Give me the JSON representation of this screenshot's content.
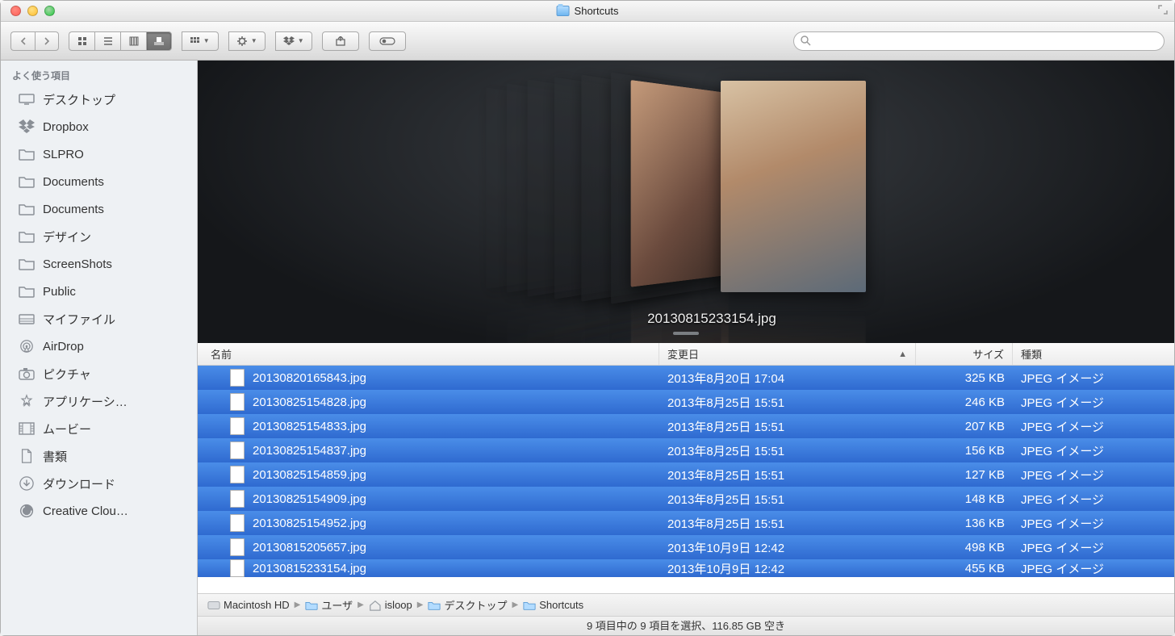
{
  "window": {
    "title": "Shortcuts"
  },
  "sidebar": {
    "section": "よく使う項目",
    "items": [
      {
        "icon": "desktop",
        "label": "デスクトップ"
      },
      {
        "icon": "dropbox",
        "label": "Dropbox"
      },
      {
        "icon": "folder",
        "label": "SLPRO"
      },
      {
        "icon": "folder",
        "label": "Documents"
      },
      {
        "icon": "folder",
        "label": "Documents"
      },
      {
        "icon": "folder",
        "label": "デザイン"
      },
      {
        "icon": "folder",
        "label": "ScreenShots"
      },
      {
        "icon": "folder",
        "label": "Public"
      },
      {
        "icon": "allmyfiles",
        "label": "マイファイル"
      },
      {
        "icon": "airdrop",
        "label": "AirDrop"
      },
      {
        "icon": "camera",
        "label": "ピクチャ"
      },
      {
        "icon": "apps",
        "label": "アプリケーシ…"
      },
      {
        "icon": "movies",
        "label": "ムービー"
      },
      {
        "icon": "document",
        "label": "書類"
      },
      {
        "icon": "downloads",
        "label": "ダウンロード"
      },
      {
        "icon": "cc",
        "label": "Creative Clou…"
      }
    ]
  },
  "coverflow": {
    "selected_label": "20130815233154.jpg"
  },
  "columns": {
    "name": "名前",
    "date": "変更日",
    "size": "サイズ",
    "kind": "種類"
  },
  "sort_indicator": "▲",
  "files": [
    {
      "name": "20130820165843.jpg",
      "date": "2013年8月20日 17:04",
      "size": "325 KB",
      "kind": "JPEG イメージ"
    },
    {
      "name": "20130825154828.jpg",
      "date": "2013年8月25日 15:51",
      "size": "246 KB",
      "kind": "JPEG イメージ"
    },
    {
      "name": "20130825154833.jpg",
      "date": "2013年8月25日 15:51",
      "size": "207 KB",
      "kind": "JPEG イメージ"
    },
    {
      "name": "20130825154837.jpg",
      "date": "2013年8月25日 15:51",
      "size": "156 KB",
      "kind": "JPEG イメージ"
    },
    {
      "name": "20130825154859.jpg",
      "date": "2013年8月25日 15:51",
      "size": "127 KB",
      "kind": "JPEG イメージ"
    },
    {
      "name": "20130825154909.jpg",
      "date": "2013年8月25日 15:51",
      "size": "148 KB",
      "kind": "JPEG イメージ"
    },
    {
      "name": "20130825154952.jpg",
      "date": "2013年8月25日 15:51",
      "size": "136 KB",
      "kind": "JPEG イメージ"
    },
    {
      "name": "20130815205657.jpg",
      "date": "2013年10月9日 12:42",
      "size": "498 KB",
      "kind": "JPEG イメージ"
    },
    {
      "name": "20130815233154.jpg",
      "date": "2013年10月9日 12:42",
      "size": "455 KB",
      "kind": "JPEG イメージ"
    }
  ],
  "path": [
    {
      "icon": "hd",
      "label": "Macintosh HD"
    },
    {
      "icon": "folder",
      "label": "ユーザ"
    },
    {
      "icon": "home",
      "label": "isloop"
    },
    {
      "icon": "folder",
      "label": "デスクトップ"
    },
    {
      "icon": "folder",
      "label": "Shortcuts"
    }
  ],
  "status": "9 項目中の 9 項目を選択、116.85 GB 空き"
}
